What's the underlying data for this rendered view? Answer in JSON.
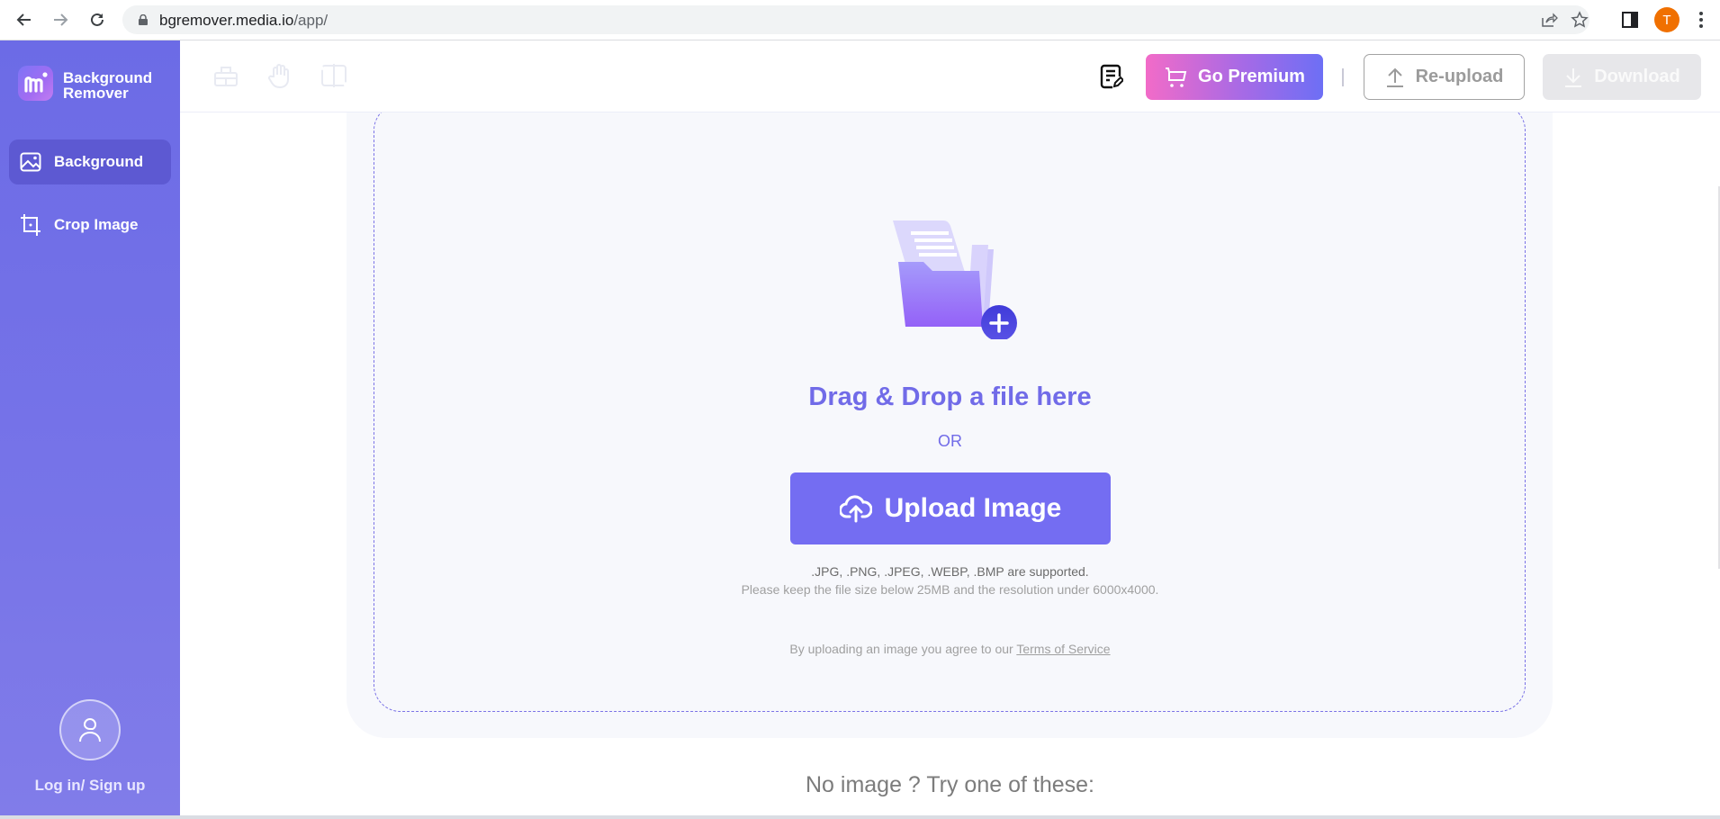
{
  "browser": {
    "url_host": "bgremover.media.io",
    "url_path": "/app/",
    "profile_initial": "T",
    "icons": [
      "back-icon",
      "forward-icon",
      "reload-icon",
      "lock-icon",
      "share-icon",
      "bookmark-star-icon",
      "side-panel-icon",
      "profile-avatar",
      "more-menu-icon"
    ]
  },
  "sidebar": {
    "app_name_line1": "Background",
    "app_name_line2": "Remover",
    "items": [
      {
        "label": "Background",
        "icon": "image-icon",
        "active": true
      },
      {
        "label": "Crop Image",
        "icon": "crop-icon",
        "active": false
      }
    ],
    "login_label": "Log in/ Sign up"
  },
  "toolbar": {
    "tools": [
      "eraser-icon",
      "hand-pan-icon",
      "compare-icon"
    ],
    "premium_label": "Go Premium",
    "reupload_label": "Re-upload",
    "download_label": "Download"
  },
  "upload": {
    "title": "Drag & Drop a file here",
    "or_label": "OR",
    "button_label": "Upload Image",
    "formats_text": ".JPG, .PNG, .JPEG, .WEBP, .BMP are supported.",
    "limits_text": "Please keep the file size below 25MB and the resolution under 6000x4000.",
    "terms_prefix": "By uploading an image you agree to our ",
    "terms_link": "Terms of Service"
  },
  "samples": {
    "prompt": "No image ? Try one of these:"
  },
  "colors": {
    "brand": "#716be8",
    "sidebar": "#6c6be6",
    "upload_button": "#746df2",
    "premium_gradient_start": "#f26bc8",
    "premium_gradient_end": "#6d6ff5"
  }
}
